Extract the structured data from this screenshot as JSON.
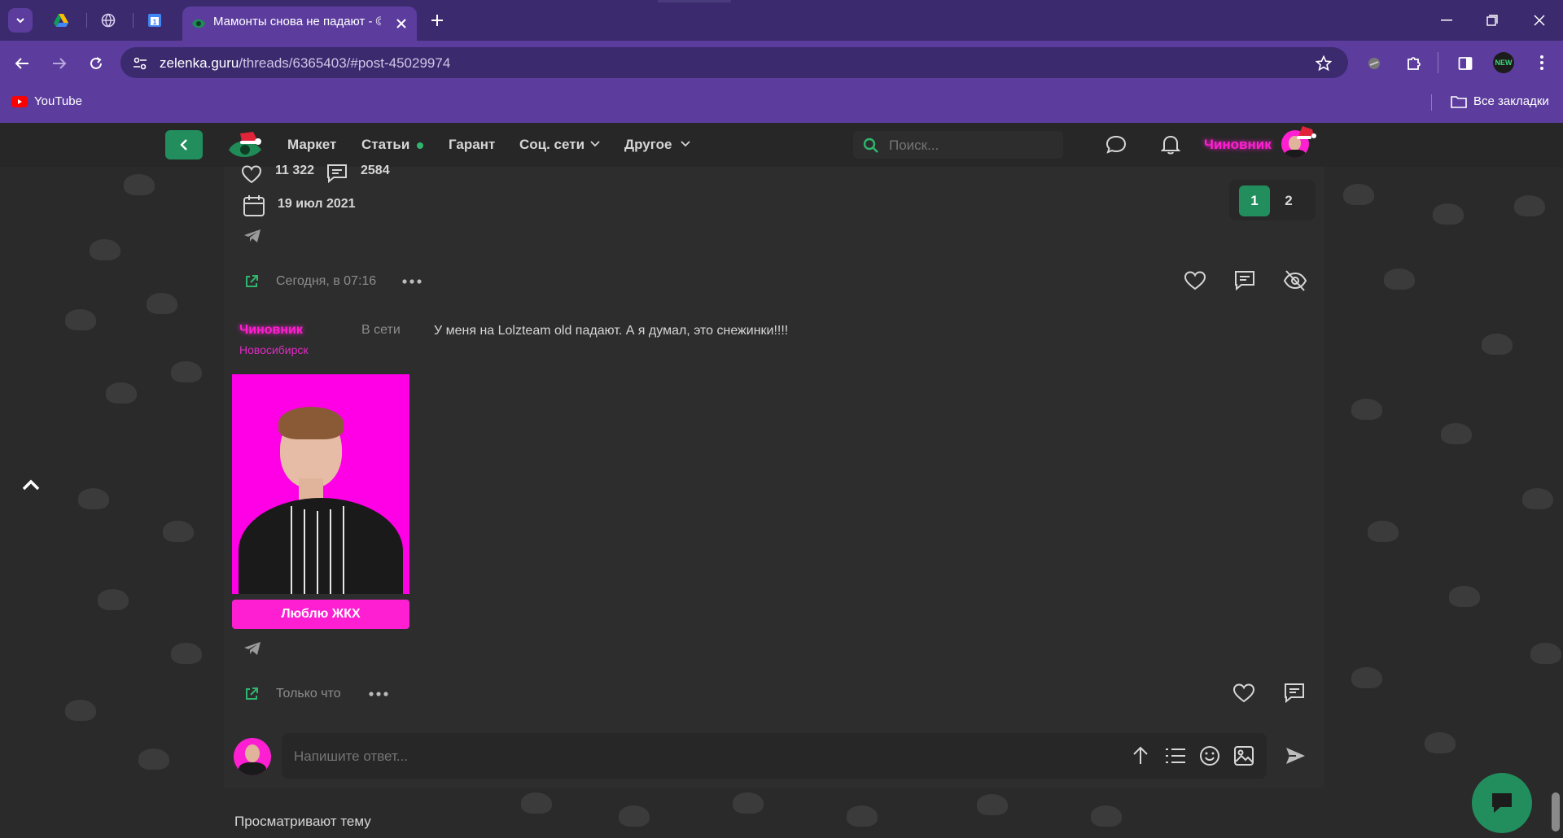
{
  "browser": {
    "tabs": [
      {
        "icon": "drive-icon"
      },
      {
        "icon": "globe-icon"
      },
      {
        "icon": "calendar-icon"
      }
    ],
    "active_tab_title": "Мамонты снова не падают - ©",
    "url_host": "zelenka.guru",
    "url_path": "/threads/6365403/#post-45029974",
    "bookmark_youtube": "YouTube",
    "all_bookmarks": "Все закладки",
    "extension_badge": "NEW"
  },
  "site": {
    "nav": {
      "market": "Маркет",
      "articles": "Статьи",
      "guarantor": "Гарант",
      "social": "Соц. сети",
      "other": "Другое",
      "search_placeholder": "Поиск...",
      "username": "Чиновник"
    },
    "thread_stats": {
      "likes": "11 322",
      "messages": "2584",
      "date": "19 июл 2021"
    },
    "pagination": [
      "1",
      "2"
    ],
    "post1": {
      "time": "Сегодня, в 07:16",
      "author": "Чиновник",
      "status": "В сети",
      "city": "Новосибирск",
      "text": "У меня на Lolzteam old падают. А я думал, это снежинки!!!!",
      "user_title": "Люблю ЖКХ"
    },
    "post2": {
      "time": "Только что"
    },
    "reply_placeholder": "Напишите ответ...",
    "viewers_label": "Просматривают тему"
  },
  "colors": {
    "accent_green": "#228e5d",
    "accent_pink": "#ff1fd2",
    "chrome_purple": "#5c3d9e"
  }
}
